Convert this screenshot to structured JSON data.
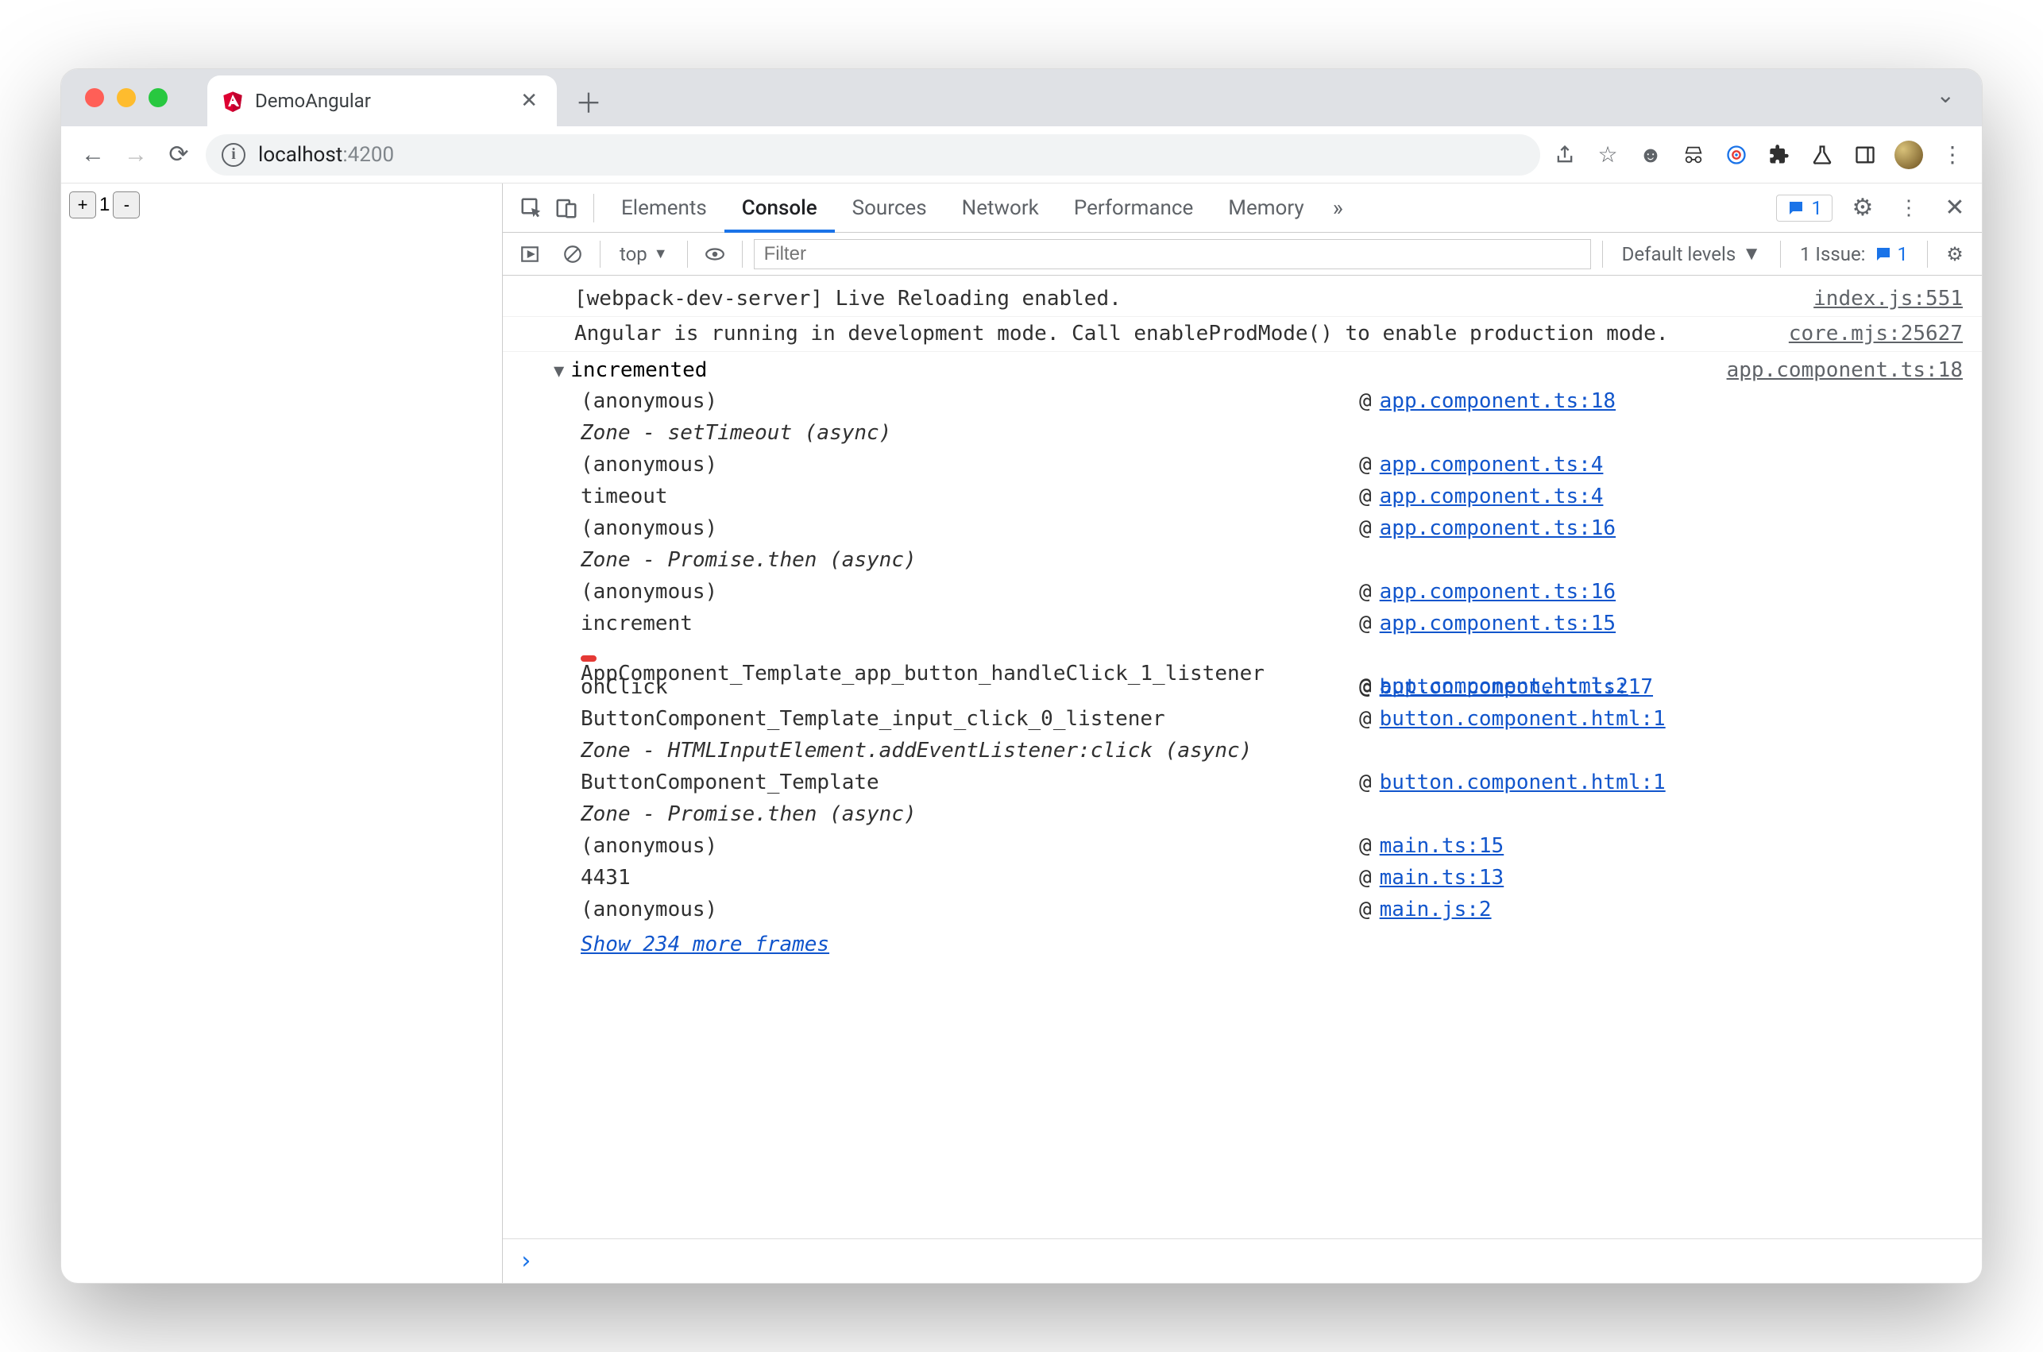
{
  "tab": {
    "title": "DemoAngular"
  },
  "url": {
    "host": "localhost",
    "port": ":4200"
  },
  "page": {
    "counter_value": "1"
  },
  "devtools": {
    "tabs": {
      "elements": "Elements",
      "console": "Console",
      "sources": "Sources",
      "network": "Network",
      "performance": "Performance",
      "memory": "Memory"
    },
    "badge_count": "1"
  },
  "console_toolbar": {
    "context": "top",
    "filter_placeholder": "Filter",
    "levels": "Default levels",
    "issues_label": "1 Issue:",
    "issues_count": "1"
  },
  "console": {
    "row1_msg": "[webpack-dev-server] Live Reloading enabled.",
    "row1_src": "index.js:551",
    "row2_msg": "Angular is running in development mode. Call enableProdMode() to enable production mode.",
    "row2_src": "core.mjs:25627",
    "group_label": "incremented",
    "group_src": "app.component.ts:18",
    "stack": {
      "f0": "(anonymous)",
      "l0": "app.component.ts:18",
      "z0": "Zone - setTimeout (async)",
      "f1": "(anonymous)",
      "l1": "app.component.ts:4",
      "f2": "timeout",
      "l2": "app.component.ts:4",
      "f3": "(anonymous)",
      "l3": "app.component.ts:16",
      "z1": "Zone - Promise.then (async)",
      "f4": "(anonymous)",
      "l4": "app.component.ts:16",
      "f5": "increment",
      "l5": "app.component.ts:15",
      "f6": "AppComponent_Template_app_button_handleClick_1_listener",
      "l6": "app.component.html:2",
      "f7": "onClick",
      "l7": "button.component.ts:17",
      "f8": "ButtonComponent_Template_input_click_0_listener",
      "l8": "button.component.html:1",
      "z2": "Zone - HTMLInputElement.addEventListener:click (async)",
      "f9": "ButtonComponent_Template",
      "l9": "button.component.html:1",
      "z3": "Zone - Promise.then (async)",
      "f10": "(anonymous)",
      "l10": "main.ts:15",
      "f11": "4431",
      "l11": "main.ts:13",
      "f12": "(anonymous)",
      "l12": "main.js:2"
    },
    "show_more": "Show 234 more frames",
    "at": "@"
  }
}
